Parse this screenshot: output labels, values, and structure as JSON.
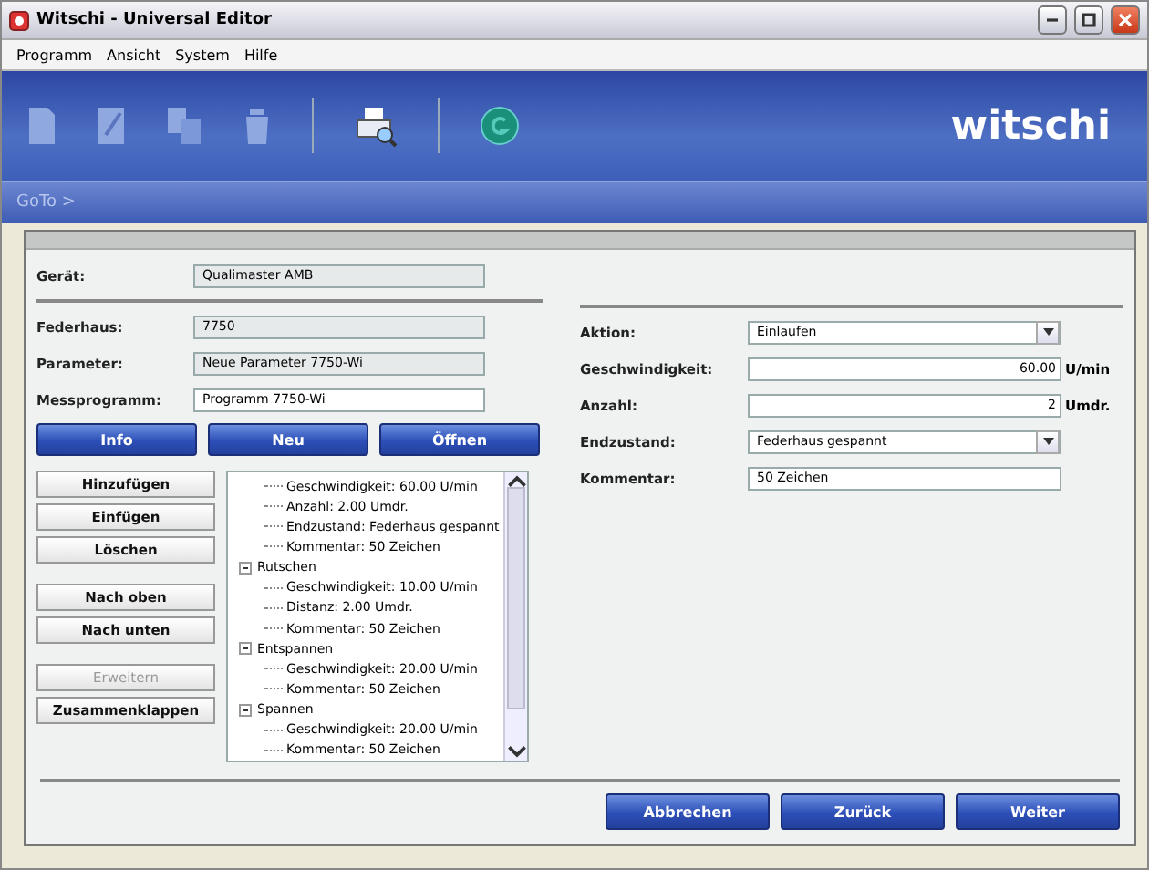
{
  "window": {
    "title": "Witschi - Universal Editor"
  },
  "menu": [
    "Programm",
    "Ansicht",
    "System",
    "Hilfe"
  ],
  "logo": {
    "text": "witschi"
  },
  "goto": "GoTo >",
  "device": {
    "label": "Gerät:",
    "value": "Qualimaster AMB"
  },
  "left_fields": [
    {
      "label": "Federhaus:",
      "value": "7750",
      "editable": false
    },
    {
      "label": "Parameter:",
      "value": "Neue Parameter 7750-Wi",
      "editable": false
    },
    {
      "label": "Messprogramm:",
      "value": "Programm 7750-Wi",
      "editable": true
    }
  ],
  "mode_buttons": [
    "Info",
    "Neu",
    "Öffnen"
  ],
  "tree_button_groups": [
    [
      {
        "label": "Hinzufügen",
        "disabled": false
      },
      {
        "label": "Einfügen",
        "disabled": false
      },
      {
        "label": "Löschen",
        "disabled": false
      }
    ],
    [
      {
        "label": "Nach oben",
        "disabled": false
      },
      {
        "label": "Nach unten",
        "disabled": false
      }
    ],
    [
      {
        "label": "Erweitern",
        "disabled": true
      },
      {
        "label": "Zusammenklappen",
        "disabled": false
      }
    ]
  ],
  "tree": [
    {
      "children": [
        {
          "label": "Geschwindigkeit: 60.00 U/min"
        },
        {
          "label": "Anzahl: 2.00 Umdr."
        },
        {
          "label": "Endzustand: Federhaus gespannt"
        },
        {
          "label": "Kommentar: 50 Zeichen"
        }
      ]
    },
    {
      "label": "Rutschen",
      "expanded": true,
      "children": [
        {
          "label": "Geschwindigkeit: 10.00 U/min"
        },
        {
          "label": "Distanz: 2.00 Umdr."
        },
        {
          "label": "Kommentar: 50 Zeichen"
        }
      ]
    },
    {
      "label": "Entspannen",
      "expanded": true,
      "children": [
        {
          "label": "Geschwindigkeit: 20.00 U/min"
        },
        {
          "label": "Kommentar: 50 Zeichen"
        }
      ]
    },
    {
      "label": "Spannen",
      "expanded": true,
      "children": [
        {
          "label": "Geschwindigkeit: 20.00 U/min"
        },
        {
          "label": "Kommentar: 50 Zeichen"
        }
      ]
    }
  ],
  "right_fields": [
    {
      "kind": "dropdown",
      "label": "Aktion:",
      "value": "Einlaufen"
    },
    {
      "kind": "number",
      "label": "Geschwindigkeit:",
      "value": "60.00",
      "unit": "U/min"
    },
    {
      "kind": "number",
      "label": "Anzahl:",
      "value": "2",
      "unit": "Umdr."
    },
    {
      "kind": "dropdown",
      "label": "Endzustand:",
      "value": "Federhaus gespannt"
    },
    {
      "kind": "text",
      "label": "Kommentar:",
      "value": "50 Zeichen"
    }
  ],
  "footer_buttons": [
    "Abbrechen",
    "Zurück",
    "Weiter"
  ]
}
